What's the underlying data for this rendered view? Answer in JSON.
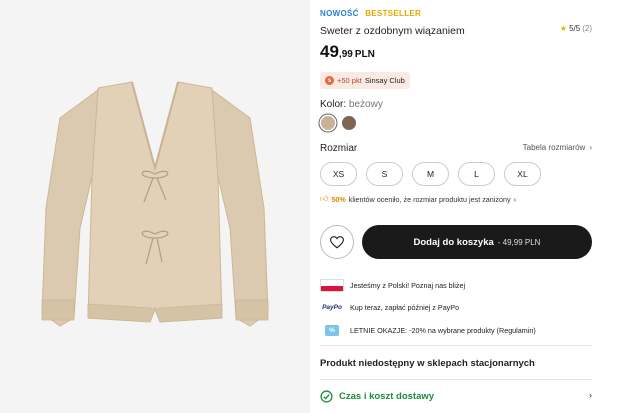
{
  "badges": {
    "new": "NOWOŚĆ",
    "bestseller": "BESTSELLER"
  },
  "rating": {
    "value": "5/5",
    "count": "(2)"
  },
  "product": {
    "title": "Sweter z ozdobnym wiązaniem",
    "price_int": "49",
    "price_dec": ",99",
    "currency": "PLN"
  },
  "club": {
    "points": "+50 pkt",
    "name": "Sinsay Club"
  },
  "color": {
    "label": "Kolor:",
    "value": "beżowy",
    "swatches": [
      "#c9b394",
      "#7e6654"
    ]
  },
  "size": {
    "label": "Rozmiar",
    "table_link": "Tabela rozmiarów",
    "options": [
      "XS",
      "S",
      "M",
      "L",
      "XL"
    ]
  },
  "fit_info": {
    "percent": "50%",
    "text": "klientów oceniło, że rozmiar produktu jest zaniżony"
  },
  "cart": {
    "label": "Dodaj do koszyka",
    "price": "- 49,99 PLN"
  },
  "info": {
    "polish": "Jesteśmy z Polski! Poznaj nas bliżej",
    "paypo_logo": "PayPo",
    "paypo": "Kup teraz, zapłać później z PayPo",
    "promo": "LETNIE OKAZJE: -20% na wybrane produkty (Regulamin)"
  },
  "store": {
    "unavailable": "Produkt niedostępny w sklepach stacjonarnych"
  },
  "delivery": {
    "label": "Czas i koszt dostawy"
  },
  "colors": {
    "accent_green": "#1f8a3c",
    "button_dark": "#1a1a1a",
    "bestseller": "#e5a800",
    "new": "#2f7fd0"
  }
}
